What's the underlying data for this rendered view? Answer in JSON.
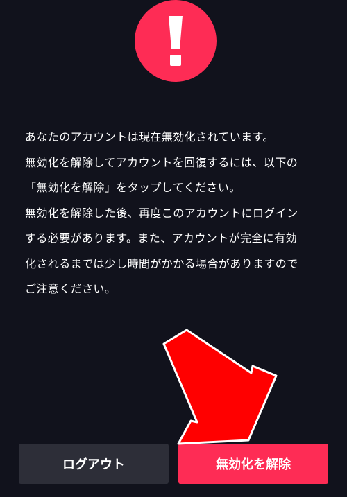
{
  "alert": {
    "icon": "exclamation-icon",
    "color": "#fe2c55"
  },
  "message": {
    "lines": [
      "あなたのアカウントは現在無効化されています。",
      "無効化を解除してアカウントを回復するには、以下の",
      "「無効化を解除」をタップしてください。",
      "無効化を解除した後、再度このアカウントにログイン",
      "する必要があります。また、アカウントが完全に有効",
      "化されるまでは少し時間がかかる場合がありますので",
      "ご注意ください。"
    ]
  },
  "buttons": {
    "logout_label": "ログアウト",
    "reactivate_label": "無効化を解除"
  },
  "colors": {
    "background": "#11121c",
    "accent": "#fe2c55",
    "secondary_button": "#2d2e38",
    "arrow": "#ff0000"
  }
}
